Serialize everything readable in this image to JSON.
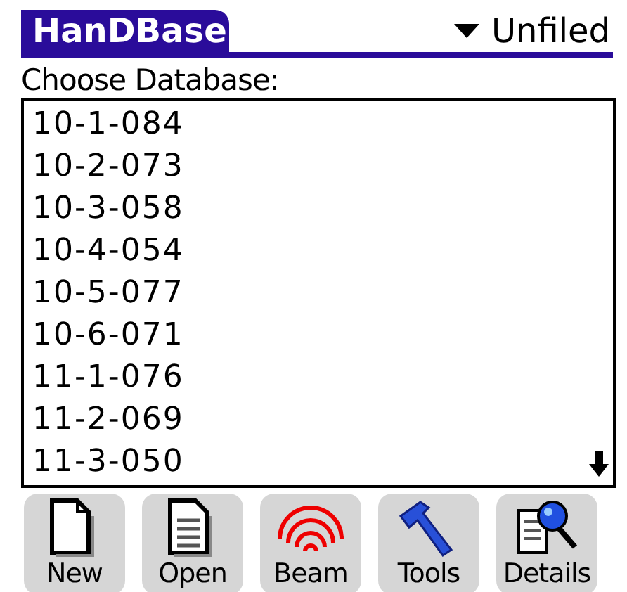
{
  "title": "HanDBase",
  "category": {
    "label": "Unfiled"
  },
  "prompt": "Choose Database:",
  "databases": [
    {
      "name": "10-1-084"
    },
    {
      "name": "10-2-073"
    },
    {
      "name": "10-3-058"
    },
    {
      "name": "10-4-054"
    },
    {
      "name": "10-5-077"
    },
    {
      "name": "10-6-071"
    },
    {
      "name": "11-1-076"
    },
    {
      "name": "11-2-069"
    },
    {
      "name": "11-3-050"
    }
  ],
  "buttons": [
    {
      "label": "New",
      "kind": "new"
    },
    {
      "label": "Open",
      "kind": "open"
    },
    {
      "label": "Beam",
      "kind": "beam"
    },
    {
      "label": "Tools",
      "kind": "tools"
    },
    {
      "label": "Details",
      "kind": "details"
    }
  ]
}
